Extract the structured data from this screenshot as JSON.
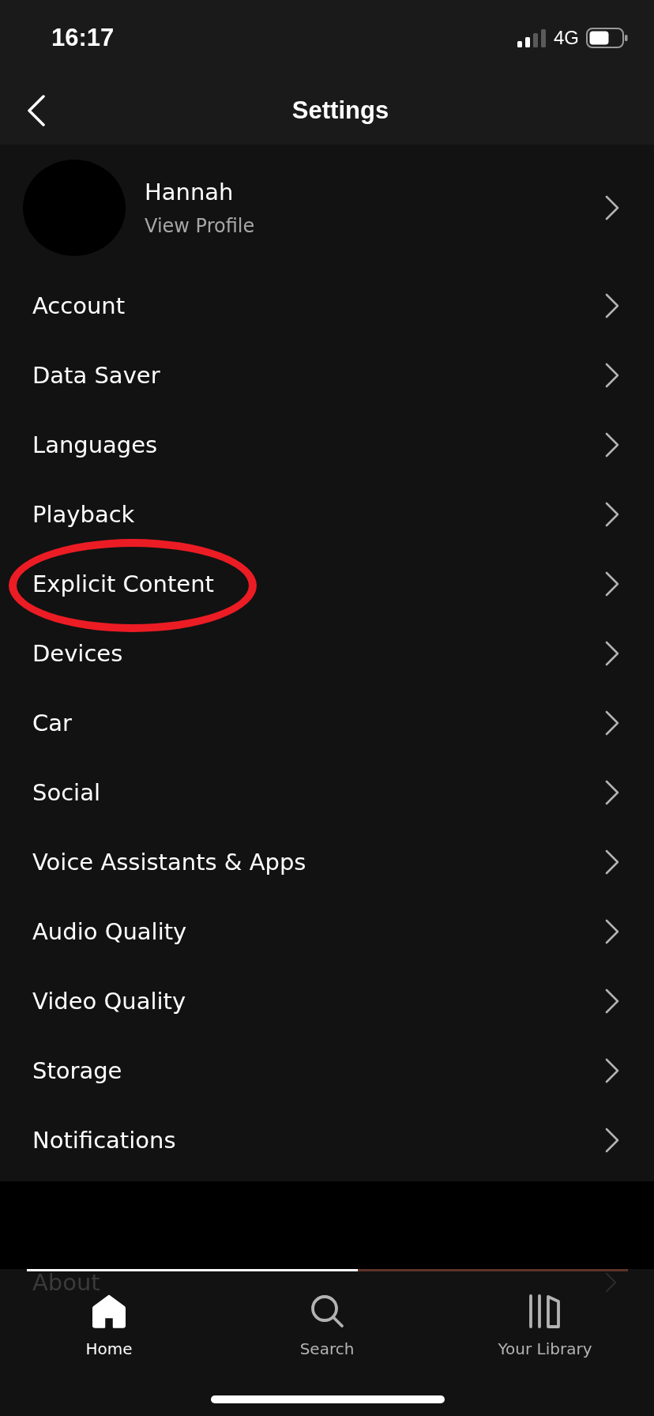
{
  "status_bar": {
    "time": "16:17",
    "network": "4G"
  },
  "header": {
    "title": "Settings"
  },
  "profile": {
    "name": "Hannah",
    "link": "View Profile"
  },
  "list": [
    {
      "label": "Account",
      "circled": false
    },
    {
      "label": "Data Saver",
      "circled": false
    },
    {
      "label": "Languages",
      "circled": false
    },
    {
      "label": "Playback",
      "circled": false
    },
    {
      "label": "Explicit Content",
      "circled": true
    },
    {
      "label": "Devices",
      "circled": false
    },
    {
      "label": "Car",
      "circled": false
    },
    {
      "label": "Social",
      "circled": false
    },
    {
      "label": "Voice Assistants & Apps",
      "circled": false
    },
    {
      "label": "Audio Quality",
      "circled": false
    },
    {
      "label": "Video Quality",
      "circled": false
    },
    {
      "label": "Storage",
      "circled": false
    },
    {
      "label": "Notifications",
      "circled": false
    }
  ],
  "section_2": [
    {
      "label": "About"
    }
  ],
  "mini_player": {
    "level": 0.55
  },
  "tabs": [
    {
      "label": "Home",
      "selected": true
    },
    {
      "label": "Search",
      "selected": false
    },
    {
      "label": "Your Library",
      "selected": false
    }
  ]
}
